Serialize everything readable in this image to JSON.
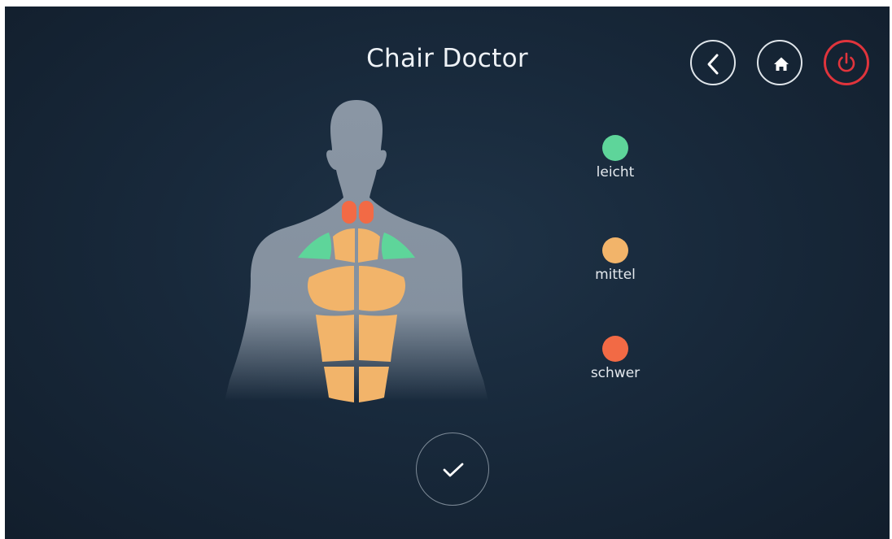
{
  "header": {
    "title": "Chair Doctor"
  },
  "icons": {
    "back": "chevron-left-icon",
    "home": "home-icon",
    "power": "power-icon",
    "confirm": "checkmark-icon"
  },
  "legend": {
    "items": [
      {
        "label": "leicht",
        "color": "#5ed59a"
      },
      {
        "label": "mittel",
        "color": "#f2b46a"
      },
      {
        "label": "schwer",
        "color": "#f26a45"
      }
    ]
  },
  "body_zones": {
    "neck": "schwer",
    "shoulders": "leicht",
    "chest": "mittel",
    "abdomen": "mittel"
  },
  "colors": {
    "background": "#18293b",
    "silhouette": "#8a96a4",
    "power_accent": "#e0343c",
    "text": "#eef2f6"
  }
}
